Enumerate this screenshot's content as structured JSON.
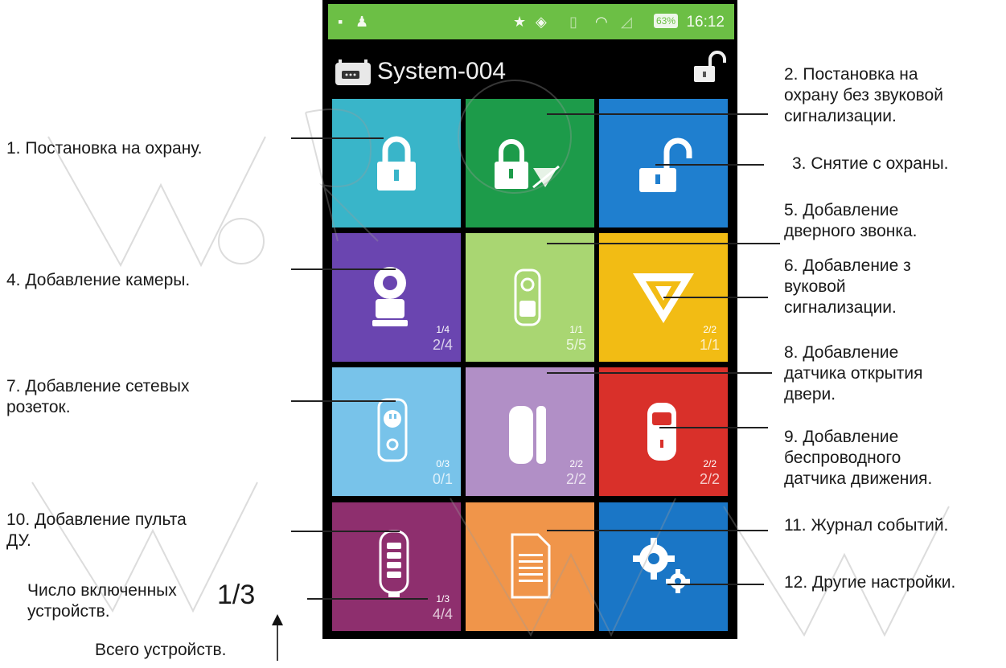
{
  "status_bar": {
    "battery": "63%",
    "time": "16:12"
  },
  "app_bar": {
    "title": "System-004"
  },
  "tiles": [
    {
      "name": "arm-tile",
      "color": "#39b5c9",
      "icon": "lock-icon"
    },
    {
      "name": "arm-silent-tile",
      "color": "#1d9b4a",
      "icon": "lock-silent-siren-icon"
    },
    {
      "name": "disarm-tile",
      "color": "#1f7fcf",
      "icon": "unlock-icon"
    },
    {
      "name": "camera-tile",
      "color": "#6a45b0",
      "icon": "camera-icon",
      "enabled": "1/4",
      "total": "2/4"
    },
    {
      "name": "doorbell-tile",
      "color": "#a9d672",
      "icon": "doorbell-icon",
      "enabled": "1/1",
      "total": "5/5"
    },
    {
      "name": "siren-tile",
      "color": "#f2bc14",
      "icon": "siren-icon",
      "enabled": "2/2",
      "total": "1/1"
    },
    {
      "name": "socket-tile",
      "color": "#78c3ea",
      "icon": "smart-socket-icon",
      "enabled": "0/3",
      "total": "0/1"
    },
    {
      "name": "door-sensor-tile",
      "color": "#b18fc6",
      "icon": "door-sensor-icon",
      "enabled": "2/2",
      "total": "2/2"
    },
    {
      "name": "motion-sensor-tile",
      "color": "#d9302a",
      "icon": "motion-sensor-icon",
      "enabled": "2/2",
      "total": "2/2"
    },
    {
      "name": "remote-tile",
      "color": "#8e2f6e",
      "icon": "remote-control-icon",
      "enabled": "1/3",
      "total": "4/4"
    },
    {
      "name": "event-log-tile",
      "color": "#f0954a",
      "icon": "document-icon"
    },
    {
      "name": "settings-tile",
      "color": "#1a76c6",
      "icon": "gears-icon"
    }
  ],
  "annotations": {
    "a1": "1. Постановка на охрану.",
    "a2": [
      "2.  Постановка на",
      "охрану без звуковой",
      "сигнализации."
    ],
    "a3": "3. Снятие с охраны.",
    "a4": "4. Добавление камеры.",
    "a5": [
      "5. Добавление",
      "дверного звонка."
    ],
    "a6": [
      "6. Добавление з",
      "вуковой",
      "сигнализации."
    ],
    "a7": [
      "7. Добавление сетевых",
      "розеток."
    ],
    "a8": [
      "8. Добавление",
      "датчика открытия",
      "двери."
    ],
    "a9": [
      "9. Добавление",
      "беспроводного",
      "датчика движения."
    ],
    "a10": [
      "10. Добавление пульта",
      "ДУ."
    ],
    "a11": "11. Журнал событий.",
    "a12": "12. Другие настройки.",
    "enabled_label": [
      "Число включенных",
      "устройств."
    ],
    "enabled_example": "1/3",
    "total_label": "Всего устройств."
  }
}
